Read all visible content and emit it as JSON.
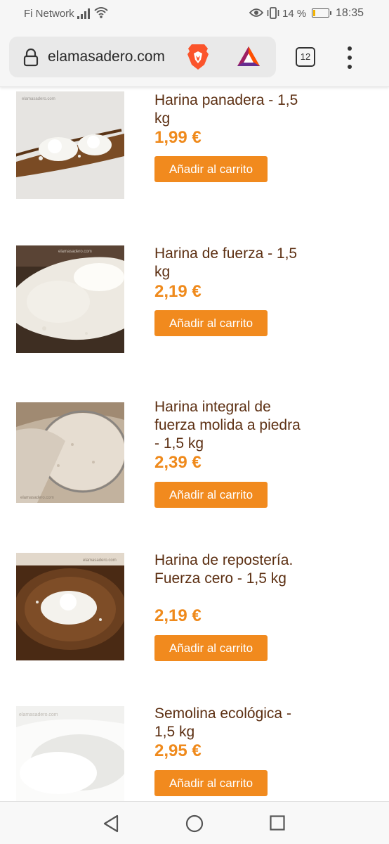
{
  "status_bar": {
    "carrier": "Fi Network",
    "battery_percent": "14 %",
    "battery_level": 0.14,
    "time": "18:35"
  },
  "browser": {
    "url": "elamasadero.com",
    "tab_count": "12"
  },
  "products": [
    {
      "title": "Harina panadera - 1,5 kg",
      "price": "1,99 €",
      "button": "Añadir al carrito",
      "watermark": "elamasadero.com"
    },
    {
      "title": "Harina de fuerza - 1,5 kg",
      "price": "2,19 €",
      "button": "Añadir al carrito",
      "watermark": "elamasadero.com"
    },
    {
      "title": "Harina integral de fuerza molida a piedra - 1,5 kg",
      "price": "2,39 €",
      "button": "Añadir al carrito",
      "watermark": "elamasadero.com"
    },
    {
      "title": "Harina de repostería. Fuerza cero - 1,5 kg",
      "price": "2,19 €",
      "button": "Añadir al carrito",
      "watermark": "elamasadero.com"
    },
    {
      "title": "Semolina ecológica - 1,5 kg",
      "price": "2,95 €",
      "button": "Añadir al carrito",
      "watermark": "elamasadero.com"
    }
  ],
  "colors": {
    "title": "#5c2f12",
    "price": "#ef8a1c",
    "button": "#f18a1e",
    "button_text": "#ffffff"
  }
}
